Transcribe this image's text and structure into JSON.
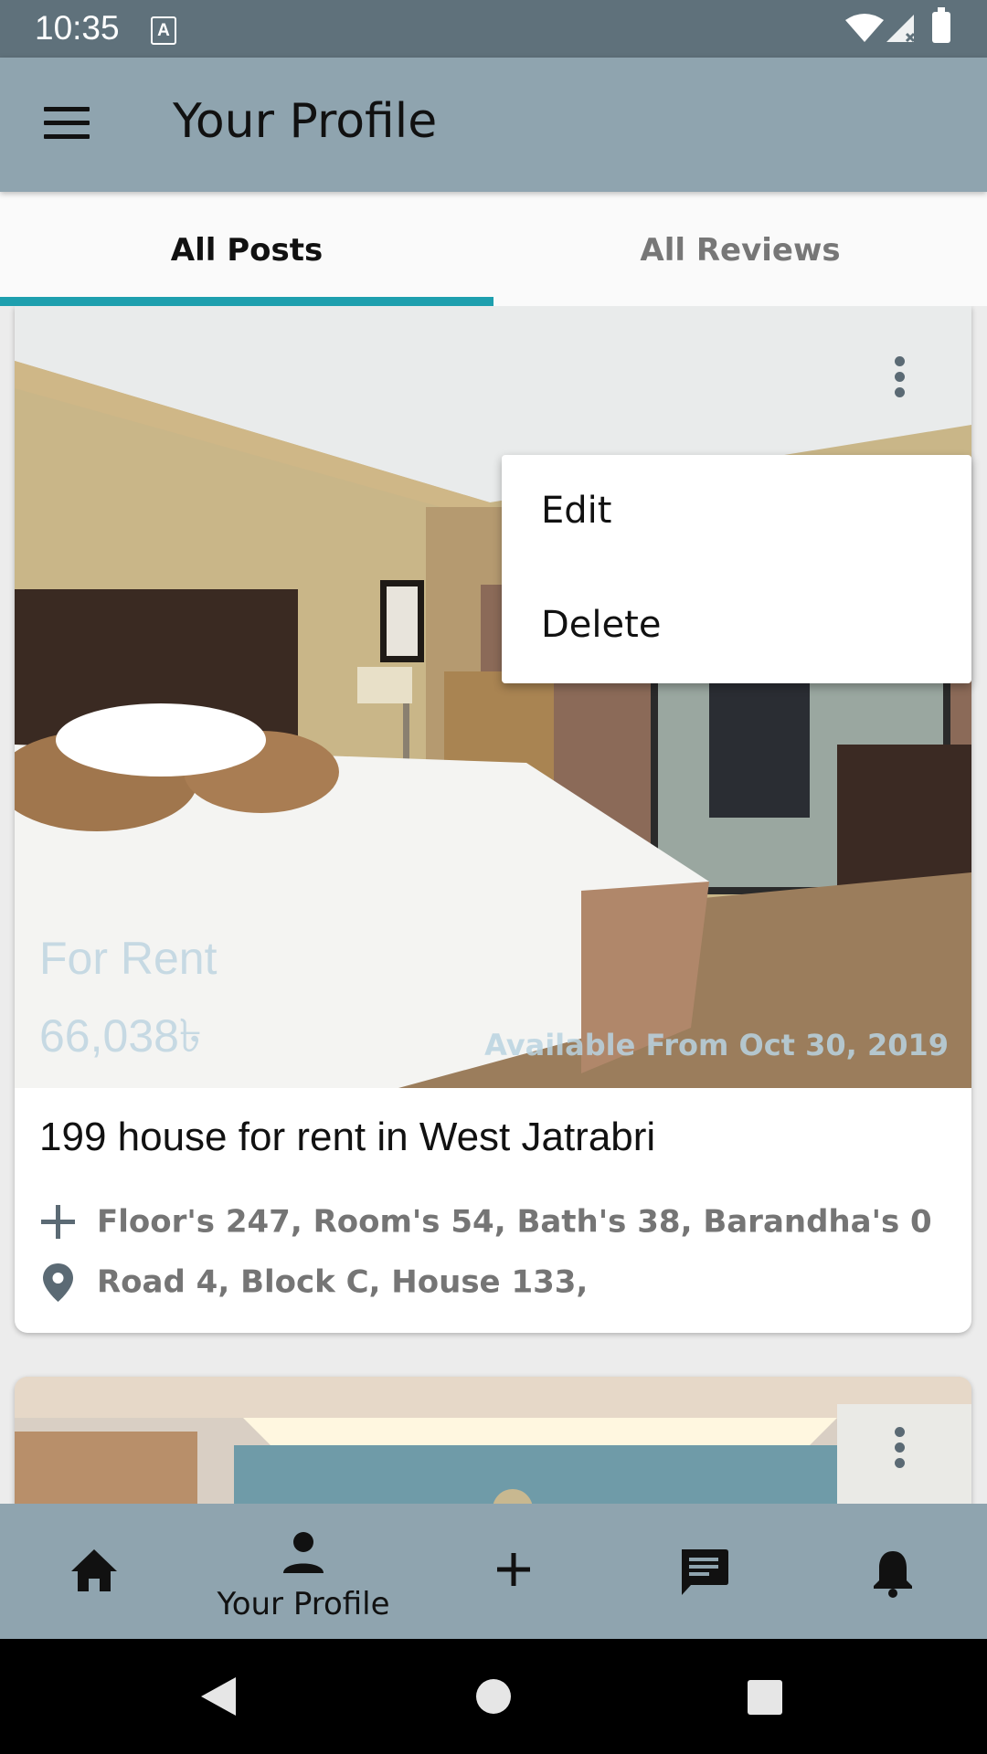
{
  "status_bar": {
    "time": "10:35",
    "a_icon_label": "A"
  },
  "app_bar": {
    "title": "Your Profile",
    "menu_icon": "menu-icon"
  },
  "tabs": [
    {
      "label": "All Posts",
      "selected": true
    },
    {
      "label": "All Reviews",
      "selected": false
    }
  ],
  "colors": {
    "app_bar": "#8fa4af",
    "status_bar": "#5f717b",
    "tab_indicator": "#1e9fae",
    "card_bg": "#ffffff"
  },
  "posts": [
    {
      "price_type": "For Rent",
      "price": "66,038৳",
      "available": "Available From Oct 30, 2019",
      "title": "199 house for rent in West Jatrabri",
      "rooms": "Floor's 247, Room's 54, Bath's 38, Barandha's 0",
      "address": "Road 4, Block C, House 133,"
    }
  ],
  "popup_menu": {
    "edit": "Edit",
    "delete": "Delete"
  },
  "bottom_nav": {
    "items": [
      {
        "icon": "home-icon"
      },
      {
        "icon": "person-icon",
        "label": "Your Profile",
        "selected": true
      },
      {
        "icon": "add-icon"
      },
      {
        "icon": "chat-icon"
      },
      {
        "icon": "bell-icon"
      }
    ]
  }
}
